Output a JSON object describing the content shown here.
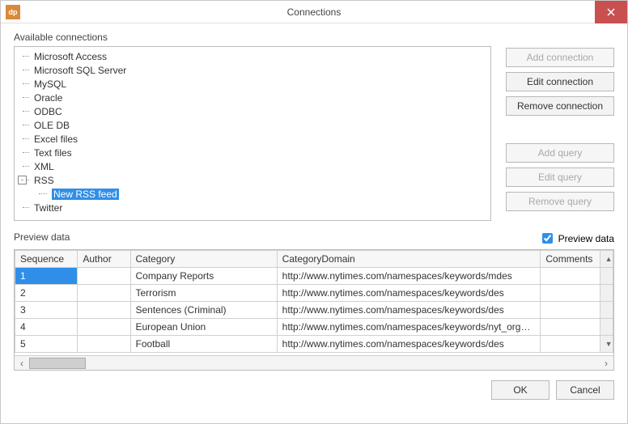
{
  "titlebar": {
    "title": "Connections",
    "app_icon_text": "dp"
  },
  "labels": {
    "available": "Available connections",
    "preview": "Preview data",
    "preview_checkbox": "Preview data"
  },
  "tree": {
    "items": [
      "Microsoft Access",
      "Microsoft SQL Server",
      "MySQL",
      "Oracle",
      "ODBC",
      "OLE DB",
      "Excel files",
      "Text files",
      "XML"
    ],
    "rss": {
      "label": "RSS",
      "toggle": "-",
      "child": "New RSS feed"
    },
    "last": "Twitter"
  },
  "buttons": {
    "add_conn": "Add connection",
    "edit_conn": "Edit connection",
    "remove_conn": "Remove connection",
    "add_query": "Add query",
    "edit_query": "Edit query",
    "remove_query": "Remove query",
    "ok": "OK",
    "cancel": "Cancel"
  },
  "grid": {
    "headers": {
      "seq": "Sequence",
      "author": "Author",
      "category": "Category",
      "cdomain": "CategoryDomain",
      "comments": "Comments"
    },
    "rows": [
      {
        "seq": "1",
        "author": "",
        "category": "Company Reports",
        "cdomain": "http://www.nytimes.com/namespaces/keywords/mdes",
        "comments": ""
      },
      {
        "seq": "2",
        "author": "",
        "category": "Terrorism",
        "cdomain": "http://www.nytimes.com/namespaces/keywords/des",
        "comments": ""
      },
      {
        "seq": "3",
        "author": "",
        "category": "Sentences (Criminal)",
        "cdomain": "http://www.nytimes.com/namespaces/keywords/des",
        "comments": ""
      },
      {
        "seq": "4",
        "author": "",
        "category": "European Union",
        "cdomain": "http://www.nytimes.com/namespaces/keywords/nyt_org_all",
        "comments": ""
      },
      {
        "seq": "5",
        "author": "",
        "category": "Football",
        "cdomain": "http://www.nytimes.com/namespaces/keywords/des",
        "comments": ""
      }
    ]
  },
  "preview_checked": true
}
